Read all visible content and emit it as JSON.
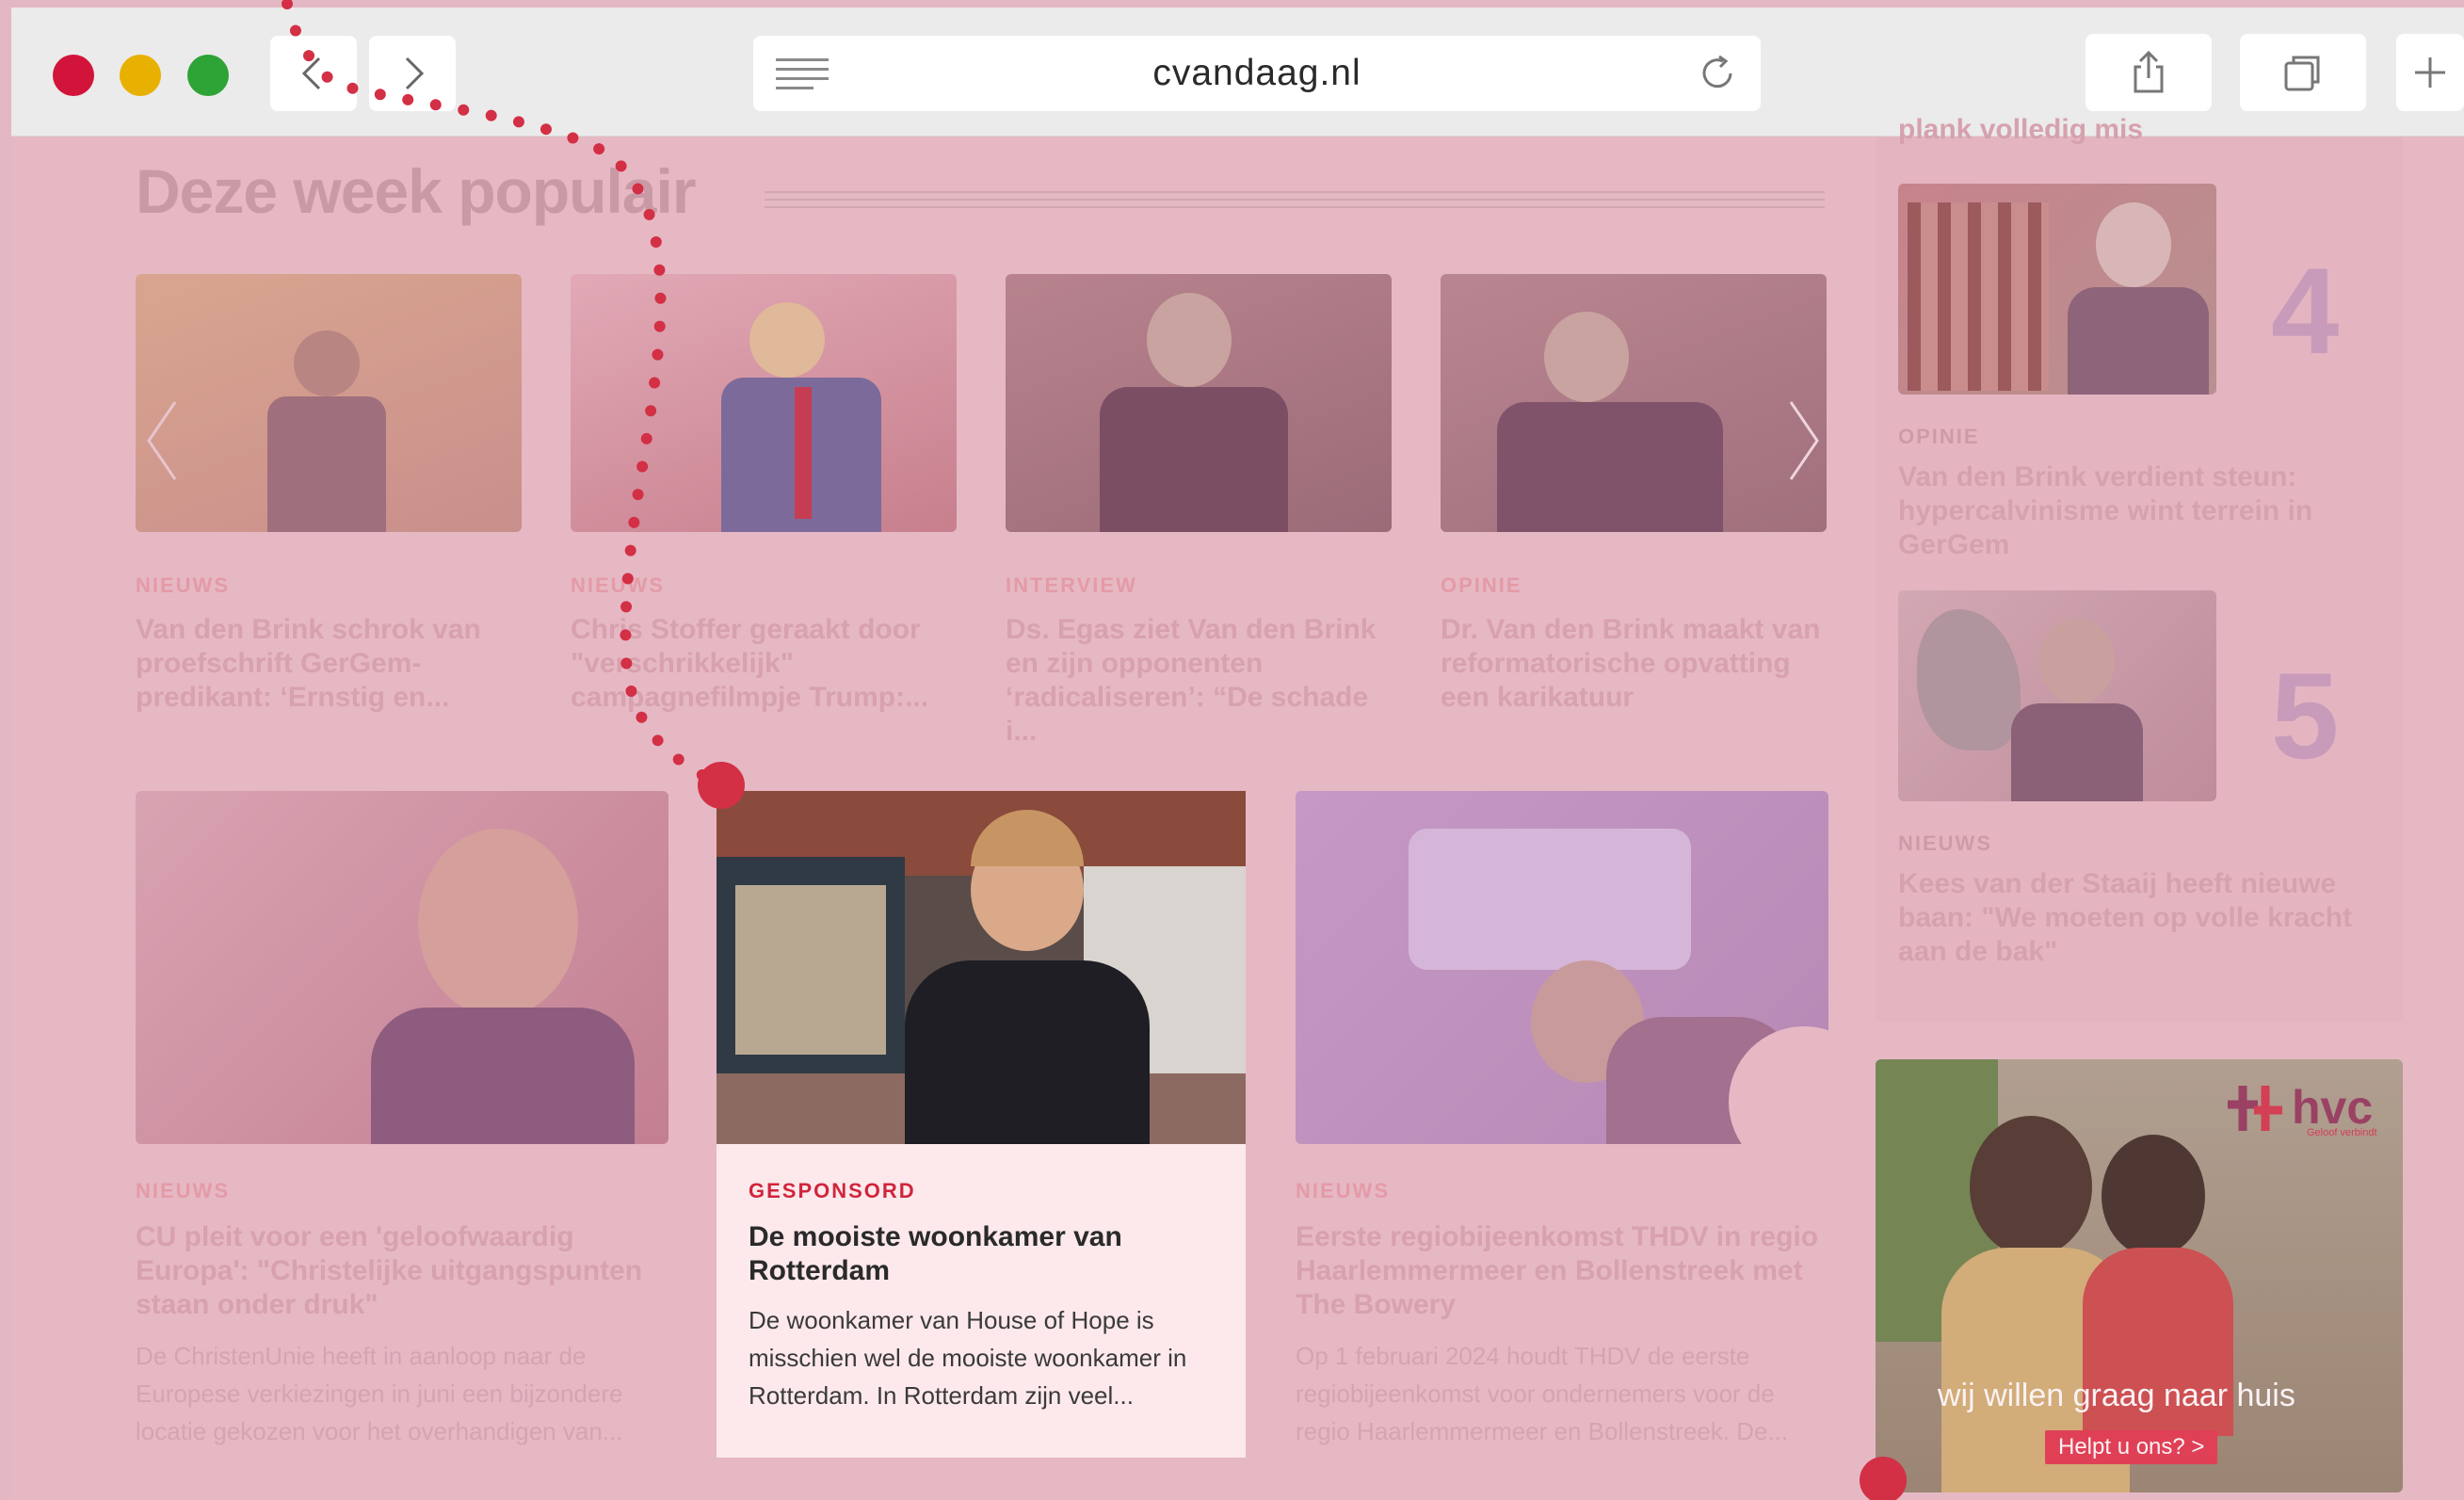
{
  "browser": {
    "url": "cvandaag.nl"
  },
  "section": {
    "title": "Deze week populair"
  },
  "carousel": [
    {
      "label": "NIEUWS",
      "headline": "Van den Brink schrok van proefschrift GerGem-predikant: ‘Ernstig en..."
    },
    {
      "label": "NIEUWS",
      "headline": "Chris Stoffer geraakt door \"verschrikkelijk\" campagnefilmpje Trump:..."
    },
    {
      "label": "INTERVIEW",
      "headline": "Ds. Egas ziet Van den Brink en zijn opponenten ‘radicaliseren’: “De schade i..."
    },
    {
      "label": "OPINIE",
      "headline": "Dr. Van den Brink maakt van reformatorische opvatting een karikatuur"
    }
  ],
  "articles": [
    {
      "label": "NIEUWS",
      "headline": "CU pleit voor een 'geloofwaardig Europa': \"Christelijke uitgangspunten staan onder druk\"",
      "desc": "De ChristenUnie heeft in aanloop naar de Europese verkiezingen in juni een bijzondere locatie gekozen voor het overhandigen van..."
    },
    {
      "label": "GESPONSORD",
      "headline": "De mooiste woonkamer van Rotterdam",
      "desc": "De woonkamer van House of Hope is misschien wel de mooiste woonkamer in Rotterdam. In Rotterdam zijn veel..."
    },
    {
      "label": "NIEUWS",
      "headline": "Eerste regiobijeenkomst THDV in regio Haarlemmermeer en Bollenstreek met The Bowery",
      "desc": "Op 1 februari 2024 houdt THDV de eerste regiobijeenkomst voor ondernemers voor de regio Haarlemmermeer en Bollenstreek. De..."
    }
  ],
  "sidebar": {
    "top_fragment": "plank volledig mis",
    "items": [
      {
        "rank": "4",
        "label": "OPINIE",
        "headline": "Van den Brink verdient steun: hypercalvinisme wint terrein in GerGem"
      },
      {
        "rank": "5",
        "label": "NIEUWS",
        "headline": "Kees van der Staaij heeft nieuwe baan: \"We moeten op volle kracht aan de bak\""
      }
    ]
  },
  "ad": {
    "brand": "hvc",
    "brand_sub": "Geloof verbindt",
    "tagline": "wij willen graag naar huis",
    "cta": "Helpt u ons? >"
  },
  "colors": {
    "overlay": "#e6b8c4",
    "accent_red": "#d0253c",
    "light_red": "#d3143a",
    "light_yellow": "#e8b000",
    "light_green": "#2ea336"
  }
}
